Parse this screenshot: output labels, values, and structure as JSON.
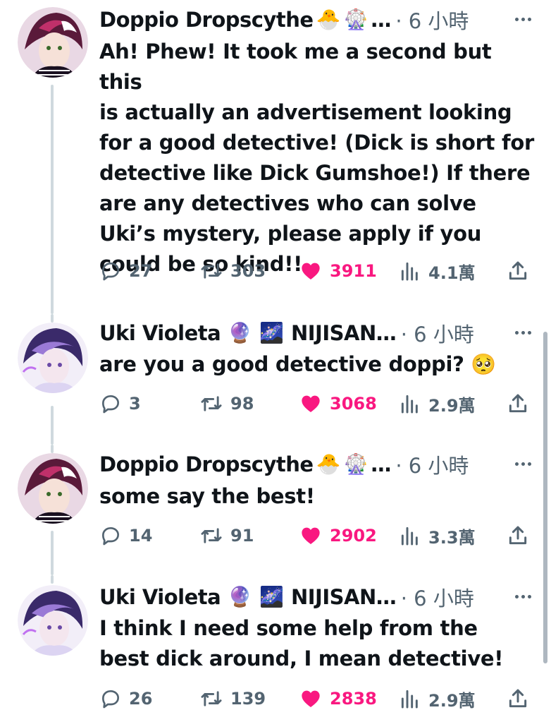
{
  "accent": {
    "like": "#f91880",
    "muted": "#536471",
    "text": "#0f1419",
    "thread": "#cfd9de"
  },
  "posts": [
    {
      "author": "Doppio Dropscythe",
      "badges": [
        "🐣",
        "🎡"
      ],
      "ellipsis": "…",
      "time": "· 6 小時",
      "text_lines": [
        "Ah! Phew! It took me a second but this",
        "is actually an advertisement looking",
        "for a good detective! (Dick is short for",
        "detective like Dick Gumshoe!) If there",
        "are any detectives who can solve",
        "Uki’s mystery, please apply if you",
        "could be so kind!!"
      ],
      "replies": "27",
      "reposts": "303",
      "likes": "3911",
      "views": "4.1萬",
      "liked": true,
      "avatar_colors": [
        "#5a1a3a",
        "#c0306a",
        "#1a1020"
      ]
    },
    {
      "author": "Uki Violeta",
      "badges": [
        "🔮",
        "🌌"
      ],
      "extra": "NIJISAN",
      "ellipsis": "…",
      "time": "· 6 小時",
      "text_lines": [
        "are you a good detective doppi? 🥺"
      ],
      "replies": "3",
      "reposts": "98",
      "likes": "3068",
      "views": "2.9萬",
      "liked": true,
      "avatar_colors": [
        "#3a2a6a",
        "#9a7ad6",
        "#dcd4f2"
      ]
    },
    {
      "author": "Doppio Dropscythe",
      "badges": [
        "🐣",
        "🎡"
      ],
      "ellipsis": "…",
      "time": "· 6 小時",
      "text_lines": [
        "some say the best!"
      ],
      "replies": "14",
      "reposts": "91",
      "likes": "2902",
      "views": "3.3萬",
      "liked": true,
      "avatar_colors": [
        "#5a1a3a",
        "#c0306a",
        "#1a1020"
      ]
    },
    {
      "author": "Uki Violeta",
      "badges": [
        "🔮",
        "🌌"
      ],
      "extra": "NIJISAN",
      "ellipsis": "…",
      "time": "· 6 小時",
      "text_lines": [
        "I think I need some help from the",
        "best dick around, I mean detective!"
      ],
      "replies": "26",
      "reposts": "139",
      "likes": "2838",
      "views": "2.9萬",
      "liked": true,
      "avatar_colors": [
        "#3a2a6a",
        "#9a7ad6",
        "#dcd4f2"
      ]
    }
  ],
  "icons": {
    "reply": "reply-icon",
    "repost": "repost-icon",
    "like": "heart-icon",
    "views": "views-icon",
    "share": "share-icon",
    "more": "more-icon"
  }
}
